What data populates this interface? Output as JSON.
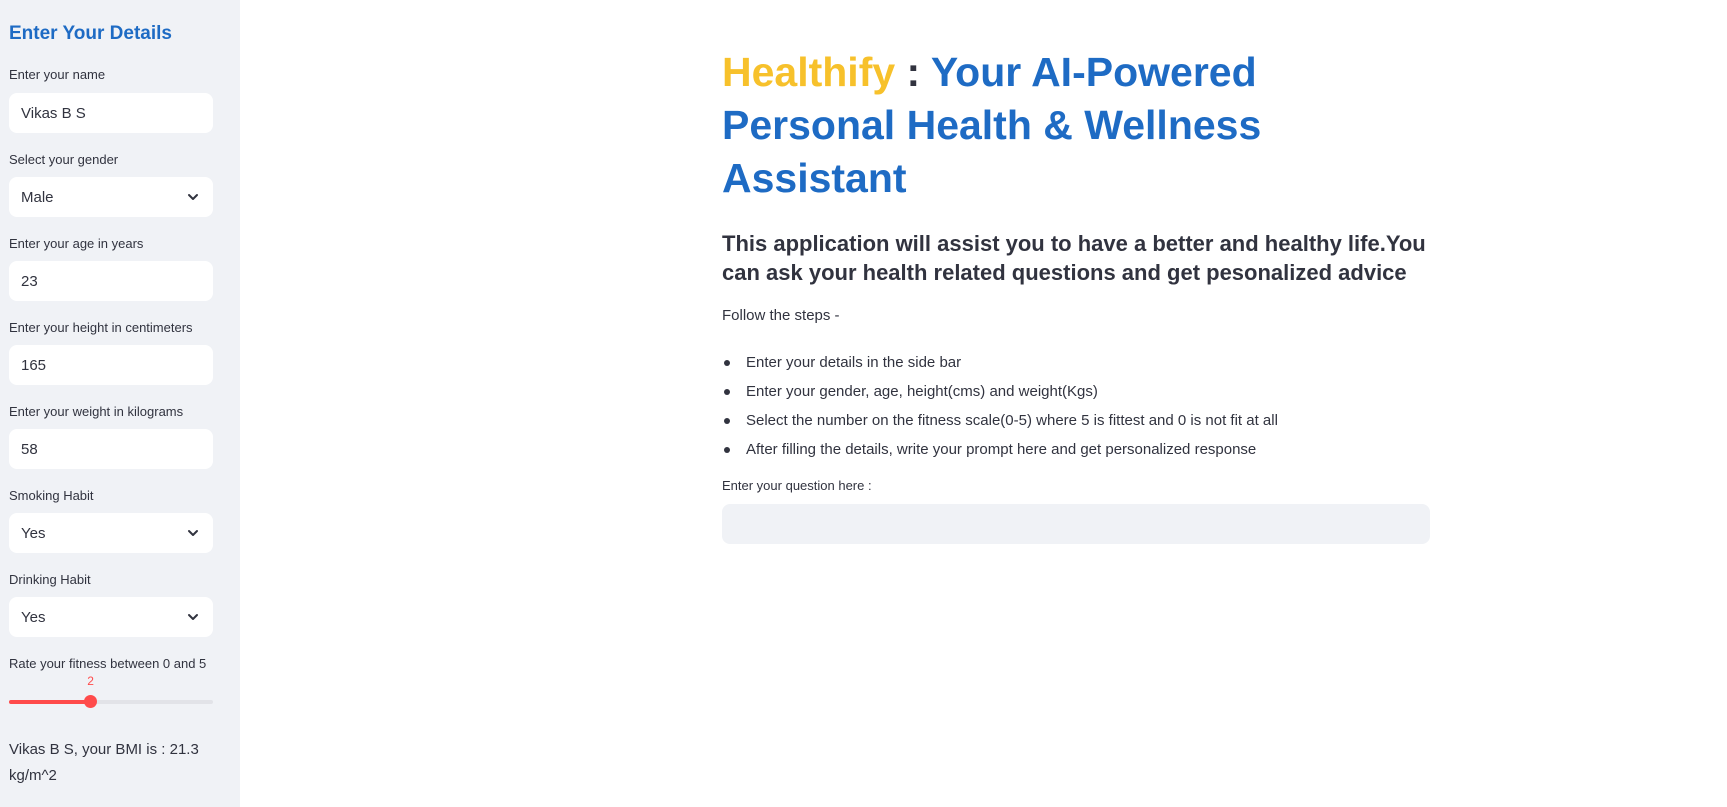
{
  "sidebar": {
    "title": "Enter Your Details",
    "name_label": "Enter your name",
    "name_value": "Vikas B S",
    "gender_label": "Select your gender",
    "gender_value": "Male",
    "age_label": "Enter your age in years",
    "age_value": "23",
    "height_label": "Enter your height in centimeters",
    "height_value": "165",
    "weight_label": "Enter your weight in kilograms",
    "weight_value": "58",
    "smoking_label": "Smoking Habit",
    "smoking_value": "Yes",
    "drinking_label": "Drinking Habit",
    "drinking_value": "Yes",
    "fitness_label": "Rate your fitness between 0 and 5",
    "fitness_value": "2",
    "fitness_min": 0,
    "fitness_max": 5,
    "bmi_text": "Vikas B S, your BMI is : 21.3 kg/m^2"
  },
  "main": {
    "brand": "Healthify",
    "colon": " : ",
    "headline_rest": "Your AI-Powered Personal Health & Wellness Assistant",
    "subheading": "This application will assist you to have a better and healthy life.You can ask your health related questions and get pesonalized advice",
    "follow_text": "Follow the steps -",
    "steps": [
      "Enter your details in the side bar",
      "Enter your gender, age, height(cms) and weight(Kgs)",
      "Select the number on the fitness scale(0-5) where 5 is fittest and 0 is not fit at all",
      "After filling the details, write your prompt here and get personalized response"
    ],
    "question_label": "Enter your question here :",
    "question_value": ""
  },
  "colors": {
    "accent_blue": "#1e6bc4",
    "brand_yellow": "#f7c12b",
    "slider_red": "#ff4b4b",
    "sidebar_bg": "#f0f2f6"
  },
  "icons": {
    "select_chevron": "chevron-down-icon"
  }
}
